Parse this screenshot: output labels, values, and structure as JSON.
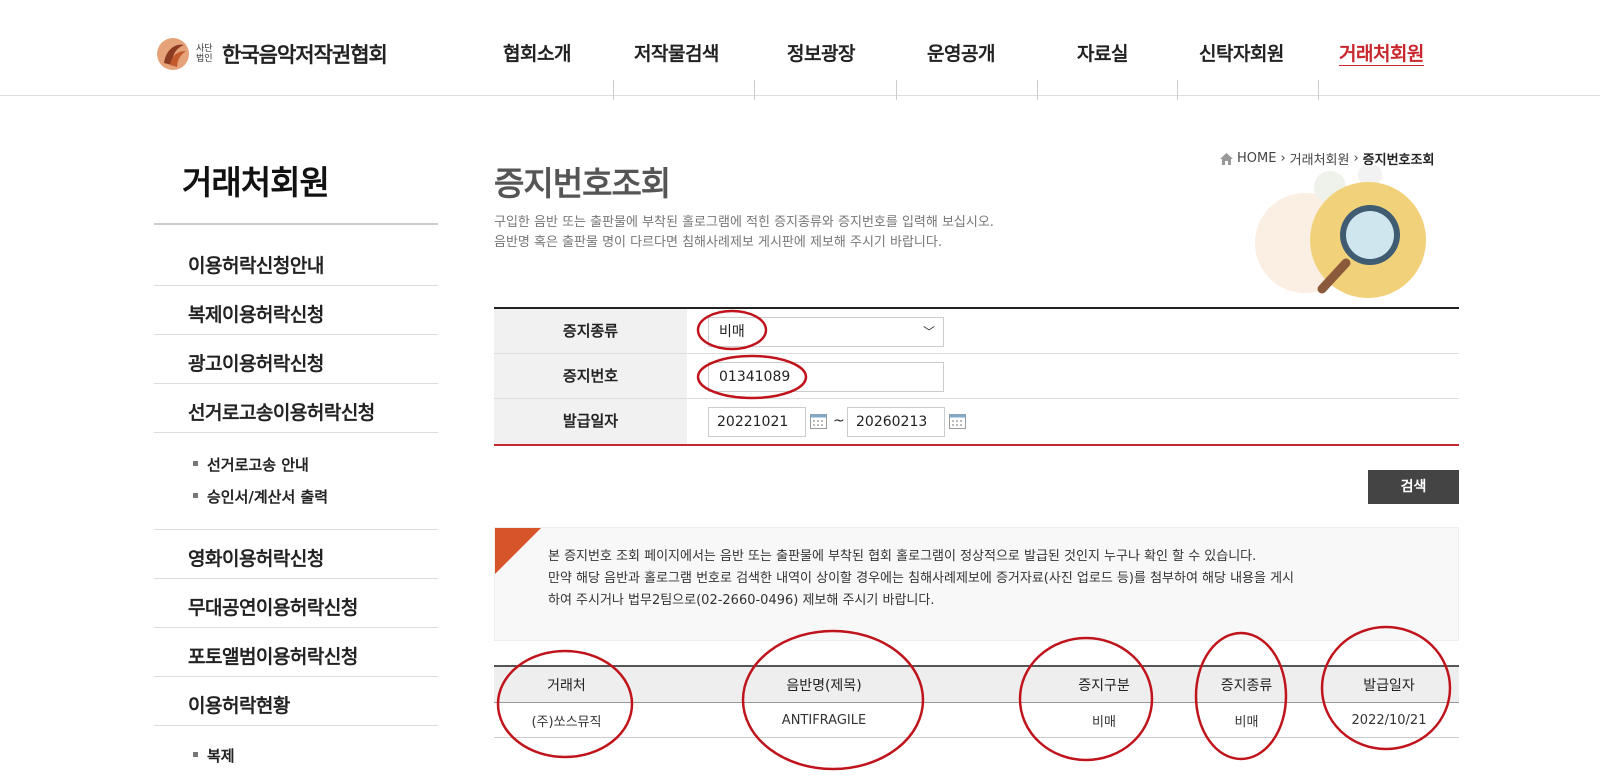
{
  "header": {
    "logo_small": "사단법인",
    "logo_name": "한국음악저작권협회",
    "nav": [
      "협회소개",
      "저작물검색",
      "정보광장",
      "운영공개",
      "자료실",
      "신탁자회원",
      "거래처회원"
    ]
  },
  "sidebar": {
    "title": "거래처회원",
    "items": [
      "이용허락신청안내",
      "복제이용허락신청",
      "광고이용허락신청",
      "선거로고송이용허락신청",
      "영화이용허락신청",
      "무대공연이용허락신청",
      "포토앨범이용허락신청",
      "이용허락현황"
    ],
    "sub_items_election": [
      "선거로고송 안내",
      "승인서/계산서 출력"
    ],
    "sub_items_status": [
      "복제"
    ]
  },
  "breadcrumb": {
    "home": "HOME",
    "level1": "거래처회원",
    "current": "증지번호조회"
  },
  "page": {
    "title": "증지번호조회",
    "desc_line1": "구입한 음반 또는 출판물에 부착된 홀로그램에 적힌 증지종류와 증지번호를 입력해 보십시오.",
    "desc_line2": "음반명 혹은 출판물 명이 다르다면 침해사례제보 게시판에 제보해 주시기 바랍니다."
  },
  "form": {
    "type_label": "증지종류",
    "type_value": "비매",
    "number_label": "증지번호",
    "number_value": "01341089",
    "date_label": "발급일자",
    "date_from": "20221021",
    "date_sep": "~",
    "date_to": "20260213",
    "search_button": "검색"
  },
  "notice": {
    "line1": "본 증지번호 조회 페이지에서는 음반 또는 출판물에 부착된 협회 홀로그램이 정상적으로 발급된 것인지 누구나 확인 할 수 있습니다.",
    "line2": "만약 해당 음반과 홀로그램 번호로 검색한 내역이 상이할 경우에는 침해사례제보에 증거자료(사진 업로드 등)를 첨부하여 해당 내용을 게시",
    "line3": "하여 주시거나 법무2팀으로(02-2660-0496) 제보해 주시기 바랍니다."
  },
  "results": {
    "headers": [
      "거래처",
      "음반명(제목)",
      "증지구분",
      "증지종류",
      "발급일자"
    ],
    "rows": [
      [
        "(주)쏘스뮤직",
        "ANTIFRAGILE",
        "비매",
        "비매",
        "2022/10/21"
      ]
    ]
  },
  "colors": {
    "accent_red": "#c8282d",
    "annotation_red": "#c0141c",
    "notice_corner": "#d7542b"
  }
}
